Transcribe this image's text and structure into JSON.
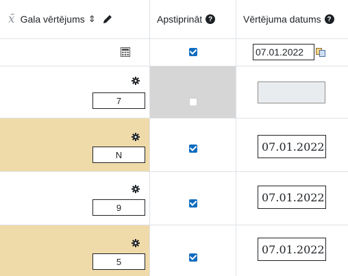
{
  "header": {
    "final_grade_symbol": "x̄",
    "final_grade_label": "Gala vērtējums",
    "sort_icon": "⇕",
    "approve_label": "Apstiprināt",
    "date_label": "Vērtējuma datums",
    "help_glyph": "?"
  },
  "toolbar": {
    "date_value": "07.01.2022",
    "approve_all_checked": true
  },
  "rows": [
    {
      "grade": "7",
      "approved": false,
      "disabled": true,
      "date": "",
      "highlight": false
    },
    {
      "grade": "N",
      "approved": true,
      "disabled": false,
      "date": "07.01.2022",
      "highlight": true
    },
    {
      "grade": "9",
      "approved": true,
      "disabled": false,
      "date": "07.01.2022",
      "highlight": false
    },
    {
      "grade": "5",
      "approved": true,
      "disabled": false,
      "date": "07.01.2022",
      "highlight": true
    }
  ],
  "colors": {
    "highlight": "#efdaa9",
    "disabled": "#d6d6d6",
    "checkbox": "#0f6cbf",
    "border": "#dee2e6"
  },
  "icons": {
    "header": [
      "pencil-icon",
      "help-icon"
    ],
    "toolbar": [
      "calculator-icon",
      "copy-icon"
    ],
    "row": [
      "gear-icon"
    ]
  }
}
